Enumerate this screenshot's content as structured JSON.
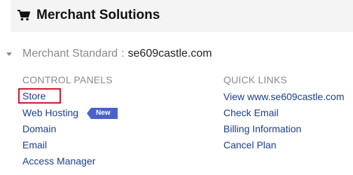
{
  "header": {
    "icon": "shopping-cart-icon",
    "title": "Merchant Solutions"
  },
  "plan": {
    "name": "Merchant Standard",
    "separator": ":",
    "domain": "se609castle.com"
  },
  "control_panels": {
    "heading": "CONTROL PANELS",
    "items": [
      {
        "label": "Store"
      },
      {
        "label": "Web Hosting",
        "badge": "New"
      },
      {
        "label": "Domain"
      },
      {
        "label": "Email"
      },
      {
        "label": "Access Manager"
      }
    ]
  },
  "quick_links": {
    "heading": "QUICK LINKS",
    "items": [
      {
        "label": "View www.se609castle.com"
      },
      {
        "label": "Check Email"
      },
      {
        "label": "Billing Information"
      },
      {
        "label": "Cancel Plan"
      }
    ]
  },
  "colors": {
    "link": "#1a3d8c",
    "muted": "#8a8a8a",
    "highlight_border": "#d6142a",
    "badge": "#4a62c8",
    "header_bg": "#f4f4f4"
  }
}
